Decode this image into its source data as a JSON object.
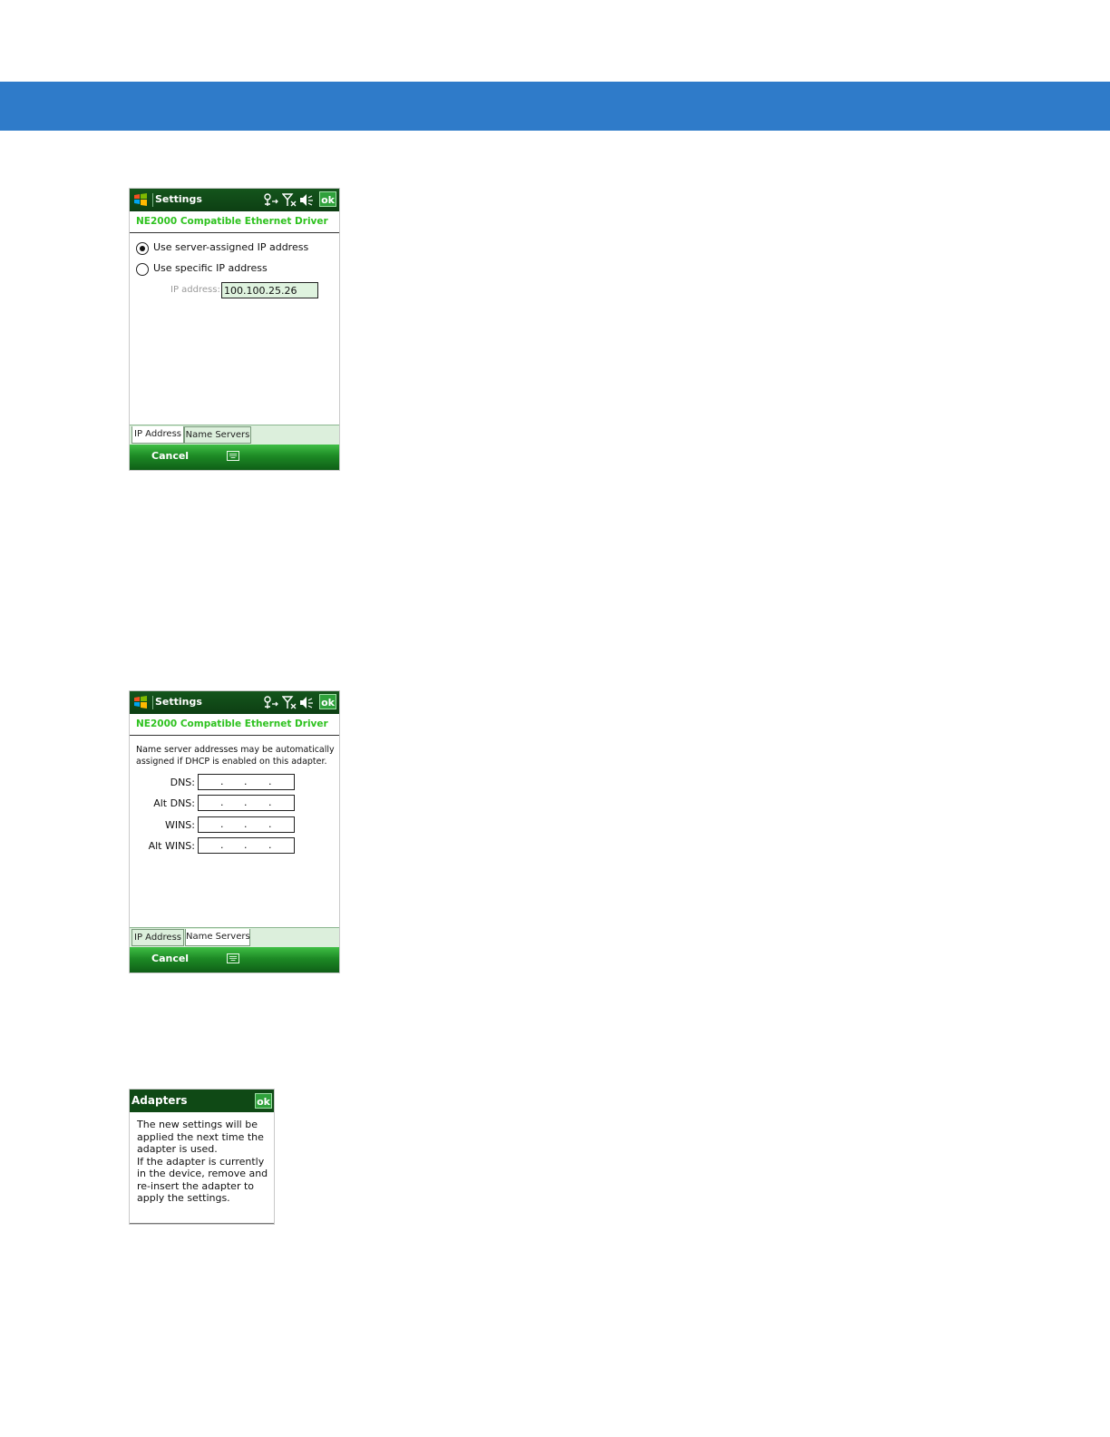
{
  "colors": {
    "banner": "#2f7bc9",
    "title_bar": "#0f4915",
    "subtitle": "#2ec21f",
    "ok": "#2fa13b"
  },
  "screens": [
    {
      "title": "Settings",
      "ok_label": "ok",
      "subtitle": "NE2000 Compatible Ethernet Driver",
      "icons": [
        "windows-start-icon",
        "connectivity-icon",
        "signal-off-icon",
        "speaker-muted-icon"
      ],
      "options": [
        {
          "label": "Use server-assigned IP address",
          "selected": true
        },
        {
          "label": "Use specific IP address",
          "selected": false
        }
      ],
      "ip_label": "IP address:",
      "ip_value": "100.100.25.26",
      "tabs": [
        "IP Address",
        "Name Servers"
      ],
      "active_tab": "IP Address",
      "softkey_left": "Cancel",
      "softkey_icon": "keyboard-icon"
    },
    {
      "title": "Settings",
      "ok_label": "ok",
      "subtitle": "NE2000 Compatible Ethernet Driver",
      "note_line1": "Name server addresses may be automatically",
      "note_line2": "assigned if DHCP is enabled on this adapter.",
      "fields": [
        {
          "label": "DNS:",
          "value": ""
        },
        {
          "label": "Alt DNS:",
          "value": ""
        },
        {
          "label": "WINS:",
          "value": ""
        },
        {
          "label": "Alt WINS:",
          "value": ""
        }
      ],
      "ip_dot": ".",
      "tabs": [
        "IP Address",
        "Name Servers"
      ],
      "active_tab": "Name Servers",
      "softkey_left": "Cancel",
      "softkey_icon": "keyboard-icon"
    }
  ],
  "dialog": {
    "title": "Adapters",
    "ok_label": "ok",
    "lines": [
      "The new settings will be",
      "applied the next time the",
      "adapter is used.",
      "If the adapter is currently",
      "in the device, remove and",
      "re-insert the adapter to",
      "apply the settings."
    ]
  }
}
